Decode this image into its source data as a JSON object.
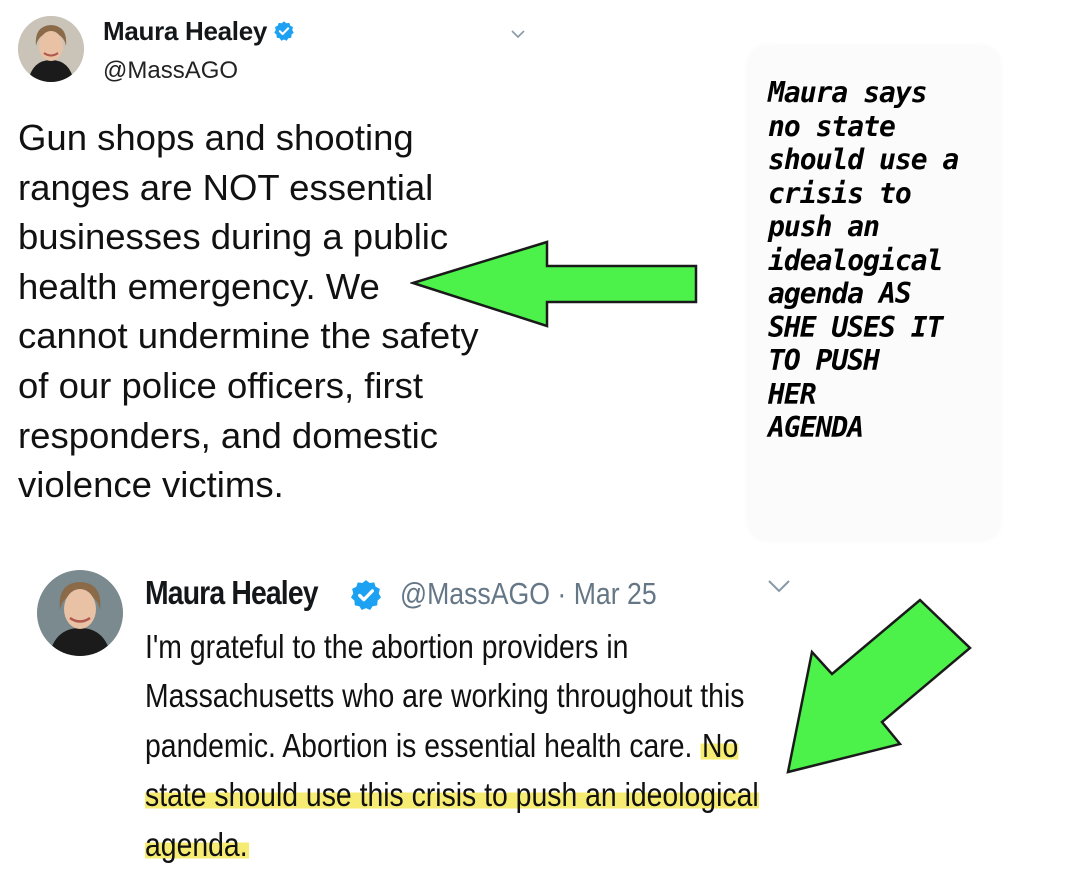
{
  "tweet1": {
    "author_name": "Maura Healey",
    "handle": "@MassAGO",
    "text": "Gun shops and shooting\nranges are NOT essential\nbusinesses during a public\nhealth emergency. We\ncannot undermine the safety\nof our police officers, first\nresponders, and domestic\nviolence victims."
  },
  "annotation": {
    "text": "Maura says\nno state\nshould use a\ncrisis to\npush an\nidealogical\nagenda AS\nSHE USES IT\nTO PUSH\nHER\nAGENDA"
  },
  "tweet2": {
    "author_name": "Maura Healey",
    "handle_date": "@MassAGO · Mar 25",
    "text_plain": "I'm grateful to the abortion providers in Massachusetts who are working throughout this pandemic. Abortion is essential health care. ",
    "text_highlighted": "No state should use this crisis to push an ideological agenda."
  },
  "colors": {
    "verified": "#1da1f2",
    "arrow_fill": "#4cf24a",
    "highlight": "#f5e85a",
    "handle_gray": "#657786"
  },
  "icons": [
    "verified-badge-icon",
    "chevron-down-icon",
    "green-arrow"
  ]
}
